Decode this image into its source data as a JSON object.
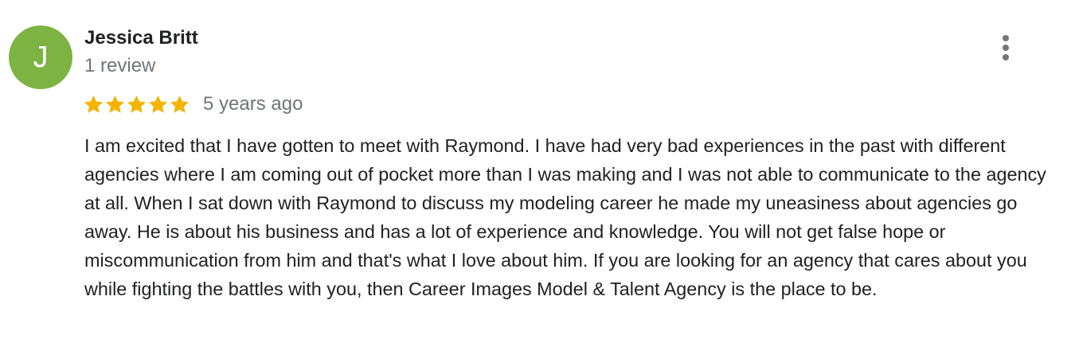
{
  "review": {
    "author": {
      "initial": "J",
      "name": "Jessica Britt",
      "review_count": "1 review",
      "avatar_color": "#7cb342"
    },
    "rating": 5,
    "rating_max": 5,
    "star_color": "#f4b400",
    "timestamp": "5 years ago",
    "text": "I am excited that I have gotten to meet with Raymond. I have had very bad experiences in the past with different agencies where I am coming out of pocket more than I was making and I was not able to communicate to the agency at all. When I sat down with Raymond to discuss my modeling career he made my uneasiness about agencies go away. He is about his business and has a lot of experience and knowledge. You will not get false hope or miscommunication from him and that's what I love about him. If you are looking for an agency that cares about you while fighting the battles with you, then Career Images Model & Talent Agency is the place to be.",
    "more_icon": "more-vert-icon"
  }
}
